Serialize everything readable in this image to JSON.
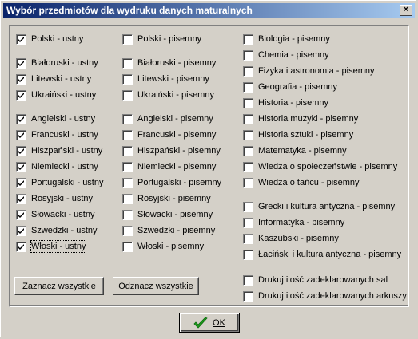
{
  "window": {
    "title": "Wybór przedmiotów dla wydruku danych maturalnych",
    "close_glyph": "×"
  },
  "col1": [
    {
      "label": "Polski - ustny",
      "checked": true
    },
    {
      "label": "Białoruski - ustny",
      "checked": true
    },
    {
      "label": "Litewski - ustny",
      "checked": true
    },
    {
      "label": "Ukraiński - ustny",
      "checked": true
    },
    {
      "label": "Angielski - ustny",
      "checked": true
    },
    {
      "label": "Francuski - ustny",
      "checked": true
    },
    {
      "label": "Hiszpański - ustny",
      "checked": true
    },
    {
      "label": "Niemiecki - ustny",
      "checked": true
    },
    {
      "label": "Portugalski - ustny",
      "checked": true
    },
    {
      "label": "Rosyjski - ustny",
      "checked": true
    },
    {
      "label": "Słowacki - ustny",
      "checked": true
    },
    {
      "label": "Szwedzki - ustny",
      "checked": true
    },
    {
      "label": "Włoski - ustny",
      "checked": true
    }
  ],
  "col2": [
    {
      "label": "Polski - pisemny",
      "checked": false
    },
    {
      "label": "Białoruski - pisemny",
      "checked": false
    },
    {
      "label": "Litewski - pisemny",
      "checked": false
    },
    {
      "label": "Ukraiński - pisemny",
      "checked": false
    },
    {
      "label": "Angielski - pisemny",
      "checked": false
    },
    {
      "label": "Francuski - pisemny",
      "checked": false
    },
    {
      "label": "Hiszpański - pisemny",
      "checked": false
    },
    {
      "label": "Niemiecki - pisemny",
      "checked": false
    },
    {
      "label": "Portugalski - pisemny",
      "checked": false
    },
    {
      "label": "Rosyjski - pisemny",
      "checked": false
    },
    {
      "label": "Słowacki - pisemny",
      "checked": false
    },
    {
      "label": "Szwedzki - pisemny",
      "checked": false
    },
    {
      "label": "Włoski - pisemny",
      "checked": false
    }
  ],
  "col3": [
    {
      "label": "Biologia - pisemny",
      "checked": false
    },
    {
      "label": "Chemia - pisemny",
      "checked": false
    },
    {
      "label": "Fizyka i astronomia - pisemny",
      "checked": false
    },
    {
      "label": "Geografia - pisemny",
      "checked": false
    },
    {
      "label": "Historia - pisemny",
      "checked": false
    },
    {
      "label": "Historia muzyki - pisemny",
      "checked": false
    },
    {
      "label": "Historia sztuki - pisemny",
      "checked": false
    },
    {
      "label": "Matematyka - pisemny",
      "checked": false
    },
    {
      "label": "Wiedza o społeczeństwie - pisemny",
      "checked": false
    },
    {
      "label": "Wiedza o tańcu - pisemny",
      "checked": false
    },
    {
      "label": "Grecki i kultura antyczna - pisemny",
      "checked": false
    },
    {
      "label": "Informatyka - pisemny",
      "checked": false
    },
    {
      "label": "Kaszubski - pisemny",
      "checked": false
    },
    {
      "label": "Łaciński i kultura antyczna - pisemny",
      "checked": false
    }
  ],
  "options": [
    {
      "label": "Drukuj ilość zadeklarowanych sal",
      "checked": false
    },
    {
      "label": "Drukuj ilość zadeklarowanych arkuszy",
      "checked": false
    }
  ],
  "buttons": {
    "select_all": "Zaznacz wszystkie",
    "deselect_all": "Odznacz wszystkie",
    "ok": "OK"
  },
  "colors": {
    "title_start": "#0a246a",
    "title_end": "#a6caf0",
    "face": "#d4d0c8",
    "ok_check": "#1c9a1c"
  }
}
